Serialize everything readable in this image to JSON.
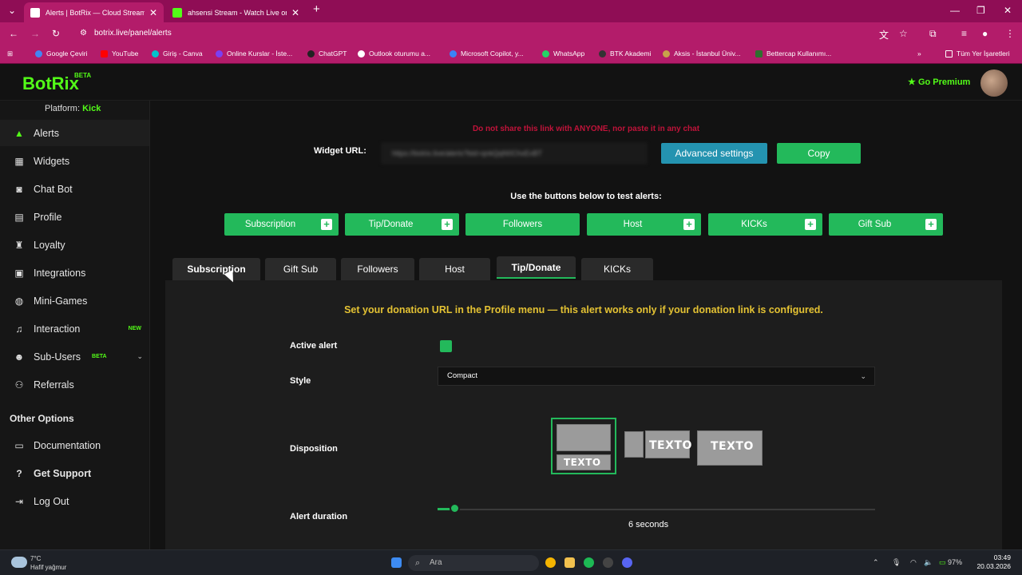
{
  "browser": {
    "tabs": [
      {
        "title": "Alerts | BotRix — Cloud Streamin",
        "active": true
      },
      {
        "title": "ahsensi Stream - Watch Live on K",
        "active": false
      }
    ],
    "url": "botrix.live/panel/alerts",
    "bookmarks": [
      "Google Çeviri",
      "YouTube",
      "Giriş - Canva",
      "Online Kurslar - İste...",
      "ChatGPT",
      "Outlook oturumu a...",
      "Microsoft Copilot, y...",
      "WhatsApp",
      "BTK Akademi",
      "Aksis - İstanbul Üniv...",
      "Bettercap Kullanımı..."
    ],
    "all_bookmarks": "Tüm Yer İşaretleri"
  },
  "header": {
    "logo": "BotRix",
    "beta": "BETA",
    "premium": "Go Premium"
  },
  "sidebar": {
    "platform_label": "Platform:",
    "platform_value": "Kick",
    "items": [
      {
        "label": "Alerts",
        "icon": "warning-icon"
      },
      {
        "label": "Widgets",
        "icon": "grid-icon"
      },
      {
        "label": "Chat Bot",
        "icon": "robot-icon"
      },
      {
        "label": "Profile",
        "icon": "id-card-icon"
      },
      {
        "label": "Loyalty",
        "icon": "trophy-icon"
      },
      {
        "label": "Integrations",
        "icon": "plug-icon"
      },
      {
        "label": "Mini-Games",
        "icon": "gamepad-icon"
      },
      {
        "label": "Interaction",
        "icon": "music-icon",
        "badge": "NEW"
      },
      {
        "label": "Sub-Users",
        "icon": "users-icon",
        "badge": "BETA"
      },
      {
        "label": "Referrals",
        "icon": "referral-icon"
      }
    ],
    "other_title": "Other Options",
    "other_items": [
      {
        "label": "Documentation",
        "icon": "book-icon"
      },
      {
        "label": "Get Support",
        "icon": "help-icon"
      },
      {
        "label": "Log Out",
        "icon": "logout-icon"
      }
    ]
  },
  "main": {
    "warning": "Do not share this link with ANYONE, nor paste it in any chat",
    "widget_url_label": "Widget URL:",
    "widget_url_value": "https://botrix.live/alerts?bid=qnkQqN0ChxEvBT",
    "advanced_button": "Advanced settings",
    "copy_button": "Copy",
    "test_label": "Use the buttons below to test alerts:",
    "test_buttons": [
      "Subscription",
      "Tip/Donate",
      "Followers",
      "Host",
      "KICKs",
      "Gift Sub"
    ],
    "tabs": [
      "Subscription",
      "Gift Sub",
      "Followers",
      "Host",
      "Tip/Donate",
      "KICKs"
    ],
    "selected_tab": "Tip/Donate",
    "panel_message": "Set your donation URL in the Profile menu — this alert works only if your donation link is configured.",
    "active_alert_label": "Active alert",
    "style_label": "Style",
    "style_value": "Compact",
    "disposition_label": "Disposition",
    "disposition_text": "TEXTO",
    "duration_label": "Alert duration",
    "duration_value": "6 seconds"
  },
  "taskbar": {
    "temperature": "7°C",
    "weather": "Hafif yağmur",
    "search_placeholder": "Ara",
    "battery": "97%",
    "time": "03:49",
    "date": "20.03.2026"
  },
  "colors": {
    "brand": "#53fc18",
    "button_green": "#23b95b",
    "button_blue": "#2493b0",
    "browser_bar": "#b31c6a",
    "warning_red": "#c0133a",
    "message_yellow": "#e4c233"
  }
}
